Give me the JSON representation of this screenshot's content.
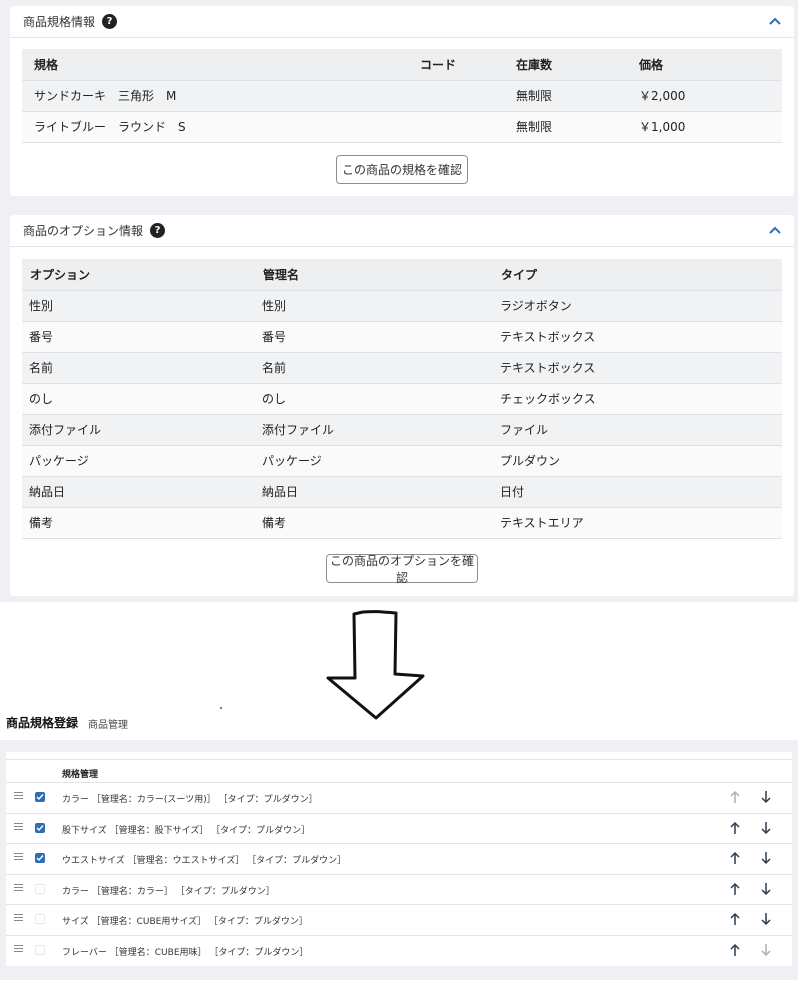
{
  "spec_panel": {
    "title": "商品規格情報",
    "help": "?",
    "columns": [
      "規格",
      "コード",
      "在庫数",
      "価格"
    ],
    "rows": [
      [
        "サンドカーキ　三角形　M",
        "",
        "無制限",
        "￥2,000"
      ],
      [
        "ライトブルー　ラウンド　S",
        "",
        "無制限",
        "￥1,000"
      ]
    ],
    "confirm_button": "この商品の規格を確認"
  },
  "option_panel": {
    "title": "商品のオプション情報",
    "help": "?",
    "columns": [
      "オプション",
      "管理名",
      "タイプ"
    ],
    "rows": [
      [
        "性別",
        "性別",
        "ラジオボタン"
      ],
      [
        "番号",
        "番号",
        "テキストボックス"
      ],
      [
        "名前",
        "名前",
        "テキストボックス"
      ],
      [
        "のし",
        "のし",
        "チェックボックス"
      ],
      [
        "添付ファイル",
        "添付ファイル",
        "ファイル"
      ],
      [
        "パッケージ",
        "パッケージ",
        "プルダウン"
      ],
      [
        "納品日",
        "納品日",
        "日付"
      ],
      [
        "備考",
        "備考",
        "テキストエリア"
      ]
    ],
    "confirm_button": "この商品のオプションを確認"
  },
  "registration": {
    "title": "商品規格登録",
    "subtitle": "商品管理",
    "column_header": "規格管理",
    "rows": [
      {
        "label": "カラー ［管理名：カラー(スーツ用)］ ［タイプ：プルダウン］",
        "checked": true
      },
      {
        "label": "股下サイズ ［管理名：股下サイズ］ ［タイプ：プルダウン］",
        "checked": true
      },
      {
        "label": "ウエストサイズ ［管理名：ウエストサイズ］ ［タイプ：プルダウン］",
        "checked": true
      },
      {
        "label": "カラー ［管理名：カラー］ ［タイプ：プルダウン］",
        "checked": false
      },
      {
        "label": "サイズ ［管理名：CUBE用サイズ］ ［タイプ：プルダウン］",
        "checked": false
      },
      {
        "label": "フレーバー ［管理名：CUBE用味］ ［タイプ：プルダウン］",
        "checked": false
      }
    ]
  },
  "colors": {
    "accent": "#2f6eb5",
    "page_bg": "#eef0f3"
  },
  "icons": {
    "help": "question-circle-icon",
    "collapse": "chevron-up-icon",
    "drag": "drag-handle-icon",
    "move_up": "arrow-up-icon",
    "move_down": "arrow-down-icon",
    "flow": "hand-drawn-down-arrow"
  }
}
